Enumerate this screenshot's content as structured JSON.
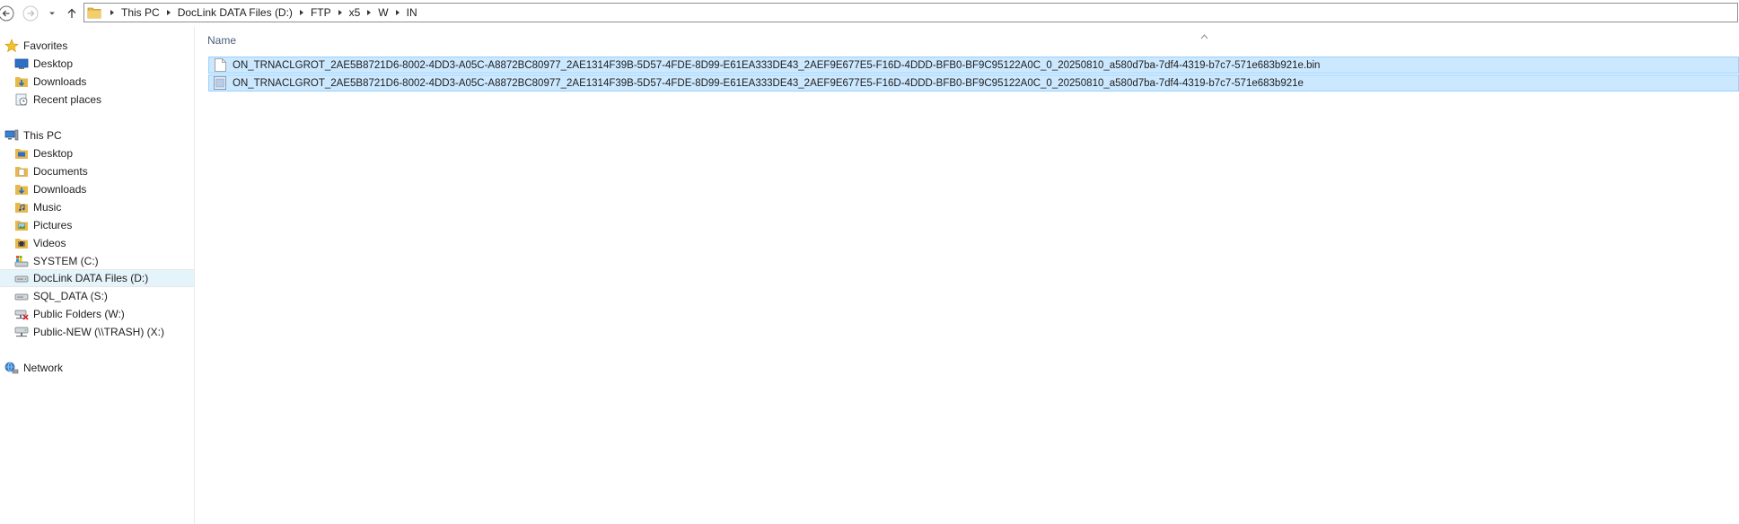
{
  "address_bar": {
    "breadcrumbs": [
      "This PC",
      "DocLink DATA Files (D:)",
      "FTP",
      "x5",
      "W",
      "IN"
    ]
  },
  "toolbar_icons": {
    "back": "back-arrow-icon",
    "forward": "forward-arrow-icon",
    "recent": "chevron-down-icon",
    "up": "up-arrow-icon"
  },
  "nav": {
    "favorites": {
      "label": "Favorites",
      "items": [
        {
          "label": "Desktop",
          "icon": "desktop-icon"
        },
        {
          "label": "Downloads",
          "icon": "downloads-icon"
        },
        {
          "label": "Recent places",
          "icon": "recent-places-icon"
        }
      ]
    },
    "this_pc": {
      "label": "This PC",
      "items": [
        {
          "label": "Desktop",
          "icon": "desktop-icon"
        },
        {
          "label": "Documents",
          "icon": "documents-icon"
        },
        {
          "label": "Downloads",
          "icon": "downloads-icon"
        },
        {
          "label": "Music",
          "icon": "music-icon"
        },
        {
          "label": "Pictures",
          "icon": "pictures-icon"
        },
        {
          "label": "Videos",
          "icon": "videos-icon"
        },
        {
          "label": "SYSTEM (C:)",
          "icon": "system-drive-icon"
        },
        {
          "label": "DocLink DATA Files (D:)",
          "icon": "drive-icon",
          "selected": true
        },
        {
          "label": "SQL_DATA (S:)",
          "icon": "drive-icon"
        },
        {
          "label": "Public Folders (W:)",
          "icon": "disconnected-network-drive-icon"
        },
        {
          "label": "Public-NEW (\\\\TRASH) (X:)",
          "icon": "network-drive-icon"
        }
      ]
    },
    "network": {
      "label": "Network",
      "icon": "network-icon"
    }
  },
  "file_list": {
    "columns": [
      "Name"
    ],
    "files": [
      {
        "name": "ON_TRNACLGROT_2AE5B8721D6-8002-4DD3-A05C-A8872BC80977_2AE1314F39B-5D57-4FDE-8D99-E61EA333DE43_2AEF9E677E5-F16D-4DDD-BFB0-BF9C95122A0C_0_20250810_a580d7ba-7df4-4319-b7c7-571e683b921e.bin",
        "icon": "blank-file-icon",
        "selected": true
      },
      {
        "name": "ON_TRNACLGROT_2AE5B8721D6-8002-4DD3-A05C-A8872BC80977_2AE1314F39B-5D57-4FDE-8D99-E61EA333DE43_2AEF9E677E5-F16D-4DDD-BFB0-BF9C95122A0C_0_20250810_a580d7ba-7df4-4319-b7c7-571e683b921e",
        "icon": "generic-file-icon",
        "selected": true
      }
    ]
  },
  "colors": {
    "selection_fill": "#cce8ff",
    "selection_border": "#99d1ff",
    "nav_selected": "#e5f3fb",
    "header_text": "#4c607a"
  }
}
